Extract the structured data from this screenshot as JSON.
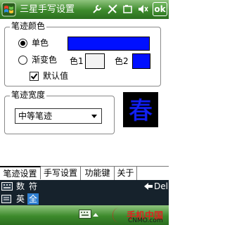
{
  "window": {
    "title": "三星手写设置",
    "ok_label": "ok"
  },
  "status_icons": [
    "wrench-icon",
    "signal-icon",
    "battery-icon",
    "volume-icon"
  ],
  "color_group": {
    "legend": "笔迹颜色",
    "single_label": "单色",
    "gradient_label": "渐变色",
    "color1_label": "色1",
    "color2_label": "色2",
    "default_label": "默认值",
    "single_selected": true,
    "default_checked": true,
    "single_color": "#0010ff",
    "color1": "#f3f3f3",
    "color2": "#0010ff"
  },
  "width_group": {
    "legend": "笔迹宽度",
    "selected": "中等笔迹",
    "preview_char": "春"
  },
  "tabs": [
    {
      "label": "笔迹设置",
      "active": true
    },
    {
      "label": "手写设置",
      "active": false
    },
    {
      "label": "功能键",
      "active": false
    },
    {
      "label": "关于",
      "active": false
    }
  ],
  "ime": {
    "row1": {
      "num": "数",
      "sym": "符",
      "del": "Del"
    },
    "row2": {
      "eng": "英",
      "all": "全"
    }
  },
  "watermark": {
    "name": "手机中国",
    "url": "CNMO.com"
  }
}
